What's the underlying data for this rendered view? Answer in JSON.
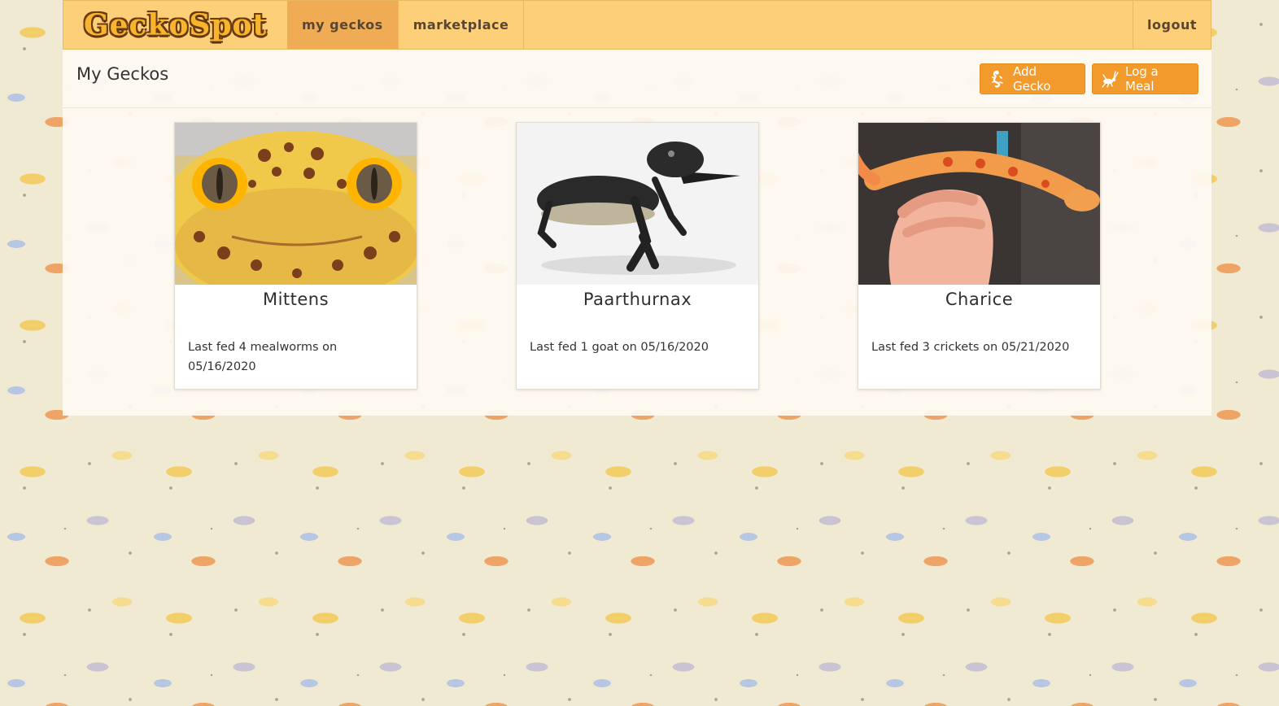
{
  "app": {
    "brand": "GeckoSpot"
  },
  "nav": {
    "links": [
      {
        "label": "my geckos",
        "active": true
      },
      {
        "label": "marketplace",
        "active": false
      }
    ],
    "logout_label": "logout"
  },
  "page": {
    "title": "My Geckos",
    "actions": {
      "add_gecko_label": "Add Gecko",
      "log_meal_label": "Log a Meal"
    }
  },
  "geckos": [
    {
      "name": "Mittens",
      "last_fed": "Last fed 4 mealworms on 05/16/2020"
    },
    {
      "name": "Paarthurnax",
      "last_fed": "Last fed 1 goat on 05/16/2020"
    },
    {
      "name": "Charice",
      "last_fed": "Last fed 3 crickets on 05/21/2020"
    }
  ],
  "colors": {
    "nav_bg": "#fdcf79",
    "nav_active": "#f0ac55",
    "button": "#f29b2c",
    "page_bg": "#f1ead3"
  }
}
